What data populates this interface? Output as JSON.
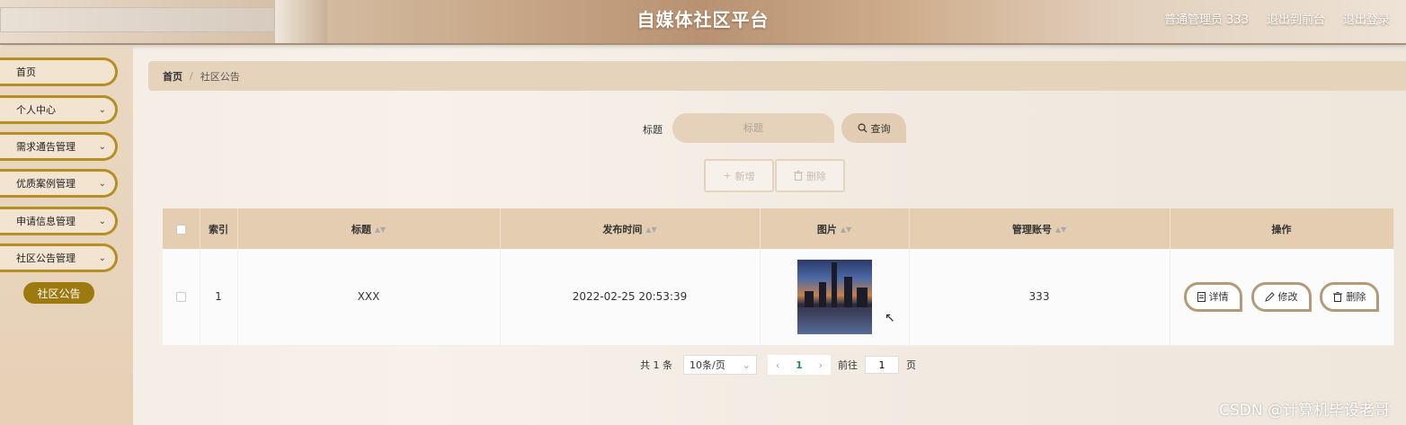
{
  "header": {
    "title": "自媒体社区平台",
    "user": "普通管理员 333",
    "back_to_front": "退出到前台",
    "logout": "退出登录"
  },
  "sidebar": {
    "items": [
      {
        "label": "首页",
        "has_chevron": false
      },
      {
        "label": "个人中心",
        "has_chevron": true
      },
      {
        "label": "需求通告管理",
        "has_chevron": true
      },
      {
        "label": "优质案例管理",
        "has_chevron": true
      },
      {
        "label": "申请信息管理",
        "has_chevron": true
      },
      {
        "label": "社区公告管理",
        "has_chevron": true
      }
    ],
    "active_sub": "社区公告"
  },
  "breadcrumb": {
    "home": "首页",
    "separator": "/",
    "current": "社区公告"
  },
  "search": {
    "label": "标题",
    "placeholder": "标题",
    "value": "",
    "button": "查询"
  },
  "actions": {
    "add": "新增",
    "delete": "删除"
  },
  "table": {
    "headers": {
      "index": "索引",
      "title": "标题",
      "publish_time": "发布时间",
      "image": "图片",
      "admin_account": "管理账号",
      "operations": "操作"
    },
    "rows": [
      {
        "index": "1",
        "title": "XXX",
        "publish_time": "2022-02-25 20:53:39",
        "admin_account": "333"
      }
    ],
    "row_actions": {
      "detail": "详情",
      "edit": "修改",
      "delete": "删除"
    }
  },
  "pagination": {
    "total": "共 1 条",
    "page_size": "10条/页",
    "current_page": "1",
    "goto_label": "前往",
    "goto_value": "1",
    "page_suffix": "页"
  },
  "watermark": "CSDN @计算机毕设老哥",
  "colors": {
    "accent": "#9c7a10",
    "header_bg": "#c9a98a",
    "table_header": "#e4cdb0"
  }
}
